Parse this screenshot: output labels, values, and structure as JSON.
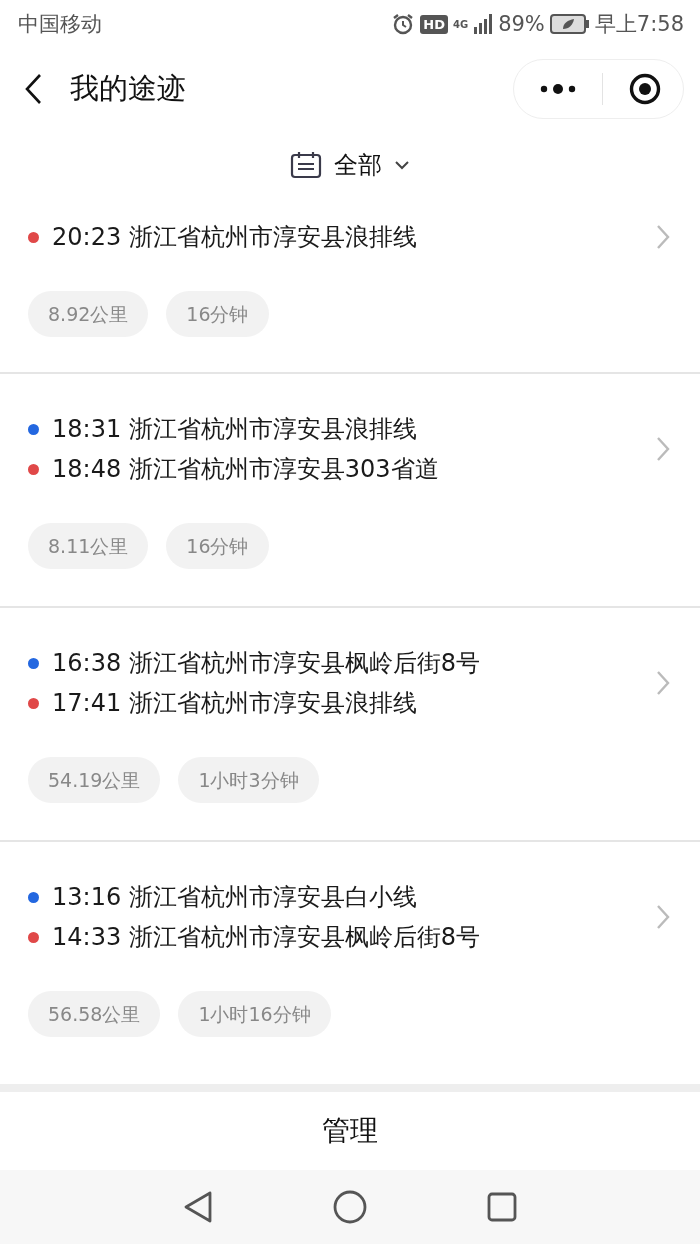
{
  "status_bar": {
    "carrier": "中国移动",
    "hd": "HD",
    "network": "4G",
    "battery": "89%",
    "time": "早上7:58"
  },
  "header": {
    "title": "我的途迹"
  },
  "filter": {
    "label": "全部"
  },
  "trips": [
    {
      "points": [
        {
          "color": "#e04848",
          "text": "20:23 浙江省杭州市淳安县浪排线"
        }
      ],
      "distance": "8.92公里",
      "duration": "16分钟"
    },
    {
      "points": [
        {
          "color": "#2367e0",
          "text": "18:31 浙江省杭州市淳安县浪排线"
        },
        {
          "color": "#e04848",
          "text": "18:48 浙江省杭州市淳安县303省道"
        }
      ],
      "distance": "8.11公里",
      "duration": "16分钟"
    },
    {
      "points": [
        {
          "color": "#2367e0",
          "text": "16:38 浙江省杭州市淳安县枫岭后街8号"
        },
        {
          "color": "#e04848",
          "text": "17:41 浙江省杭州市淳安县浪排线"
        }
      ],
      "distance": "54.19公里",
      "duration": "1小时3分钟"
    },
    {
      "points": [
        {
          "color": "#2367e0",
          "text": "13:16 浙江省杭州市淳安县白小线"
        },
        {
          "color": "#e04848",
          "text": "14:33 浙江省杭州市淳安县枫岭后街8号"
        }
      ],
      "distance": "56.58公里",
      "duration": "1小时16分钟"
    }
  ],
  "footer": {
    "button": "管理"
  }
}
